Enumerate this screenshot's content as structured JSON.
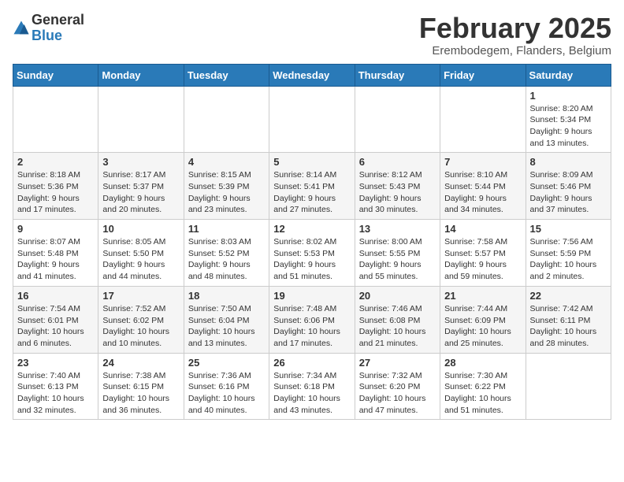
{
  "header": {
    "logo_general": "General",
    "logo_blue": "Blue",
    "month_title": "February 2025",
    "location": "Erembodegem, Flanders, Belgium"
  },
  "days_of_week": [
    "Sunday",
    "Monday",
    "Tuesday",
    "Wednesday",
    "Thursday",
    "Friday",
    "Saturday"
  ],
  "weeks": [
    {
      "shaded": false,
      "days": [
        {
          "number": "",
          "text": ""
        },
        {
          "number": "",
          "text": ""
        },
        {
          "number": "",
          "text": ""
        },
        {
          "number": "",
          "text": ""
        },
        {
          "number": "",
          "text": ""
        },
        {
          "number": "",
          "text": ""
        },
        {
          "number": "1",
          "text": "Sunrise: 8:20 AM\nSunset: 5:34 PM\nDaylight: 9 hours and 13 minutes."
        }
      ]
    },
    {
      "shaded": true,
      "days": [
        {
          "number": "2",
          "text": "Sunrise: 8:18 AM\nSunset: 5:36 PM\nDaylight: 9 hours and 17 minutes."
        },
        {
          "number": "3",
          "text": "Sunrise: 8:17 AM\nSunset: 5:37 PM\nDaylight: 9 hours and 20 minutes."
        },
        {
          "number": "4",
          "text": "Sunrise: 8:15 AM\nSunset: 5:39 PM\nDaylight: 9 hours and 23 minutes."
        },
        {
          "number": "5",
          "text": "Sunrise: 8:14 AM\nSunset: 5:41 PM\nDaylight: 9 hours and 27 minutes."
        },
        {
          "number": "6",
          "text": "Sunrise: 8:12 AM\nSunset: 5:43 PM\nDaylight: 9 hours and 30 minutes."
        },
        {
          "number": "7",
          "text": "Sunrise: 8:10 AM\nSunset: 5:44 PM\nDaylight: 9 hours and 34 minutes."
        },
        {
          "number": "8",
          "text": "Sunrise: 8:09 AM\nSunset: 5:46 PM\nDaylight: 9 hours and 37 minutes."
        }
      ]
    },
    {
      "shaded": false,
      "days": [
        {
          "number": "9",
          "text": "Sunrise: 8:07 AM\nSunset: 5:48 PM\nDaylight: 9 hours and 41 minutes."
        },
        {
          "number": "10",
          "text": "Sunrise: 8:05 AM\nSunset: 5:50 PM\nDaylight: 9 hours and 44 minutes."
        },
        {
          "number": "11",
          "text": "Sunrise: 8:03 AM\nSunset: 5:52 PM\nDaylight: 9 hours and 48 minutes."
        },
        {
          "number": "12",
          "text": "Sunrise: 8:02 AM\nSunset: 5:53 PM\nDaylight: 9 hours and 51 minutes."
        },
        {
          "number": "13",
          "text": "Sunrise: 8:00 AM\nSunset: 5:55 PM\nDaylight: 9 hours and 55 minutes."
        },
        {
          "number": "14",
          "text": "Sunrise: 7:58 AM\nSunset: 5:57 PM\nDaylight: 9 hours and 59 minutes."
        },
        {
          "number": "15",
          "text": "Sunrise: 7:56 AM\nSunset: 5:59 PM\nDaylight: 10 hours and 2 minutes."
        }
      ]
    },
    {
      "shaded": true,
      "days": [
        {
          "number": "16",
          "text": "Sunrise: 7:54 AM\nSunset: 6:01 PM\nDaylight: 10 hours and 6 minutes."
        },
        {
          "number": "17",
          "text": "Sunrise: 7:52 AM\nSunset: 6:02 PM\nDaylight: 10 hours and 10 minutes."
        },
        {
          "number": "18",
          "text": "Sunrise: 7:50 AM\nSunset: 6:04 PM\nDaylight: 10 hours and 13 minutes."
        },
        {
          "number": "19",
          "text": "Sunrise: 7:48 AM\nSunset: 6:06 PM\nDaylight: 10 hours and 17 minutes."
        },
        {
          "number": "20",
          "text": "Sunrise: 7:46 AM\nSunset: 6:08 PM\nDaylight: 10 hours and 21 minutes."
        },
        {
          "number": "21",
          "text": "Sunrise: 7:44 AM\nSunset: 6:09 PM\nDaylight: 10 hours and 25 minutes."
        },
        {
          "number": "22",
          "text": "Sunrise: 7:42 AM\nSunset: 6:11 PM\nDaylight: 10 hours and 28 minutes."
        }
      ]
    },
    {
      "shaded": false,
      "days": [
        {
          "number": "23",
          "text": "Sunrise: 7:40 AM\nSunset: 6:13 PM\nDaylight: 10 hours and 32 minutes."
        },
        {
          "number": "24",
          "text": "Sunrise: 7:38 AM\nSunset: 6:15 PM\nDaylight: 10 hours and 36 minutes."
        },
        {
          "number": "25",
          "text": "Sunrise: 7:36 AM\nSunset: 6:16 PM\nDaylight: 10 hours and 40 minutes."
        },
        {
          "number": "26",
          "text": "Sunrise: 7:34 AM\nSunset: 6:18 PM\nDaylight: 10 hours and 43 minutes."
        },
        {
          "number": "27",
          "text": "Sunrise: 7:32 AM\nSunset: 6:20 PM\nDaylight: 10 hours and 47 minutes."
        },
        {
          "number": "28",
          "text": "Sunrise: 7:30 AM\nSunset: 6:22 PM\nDaylight: 10 hours and 51 minutes."
        },
        {
          "number": "",
          "text": ""
        }
      ]
    }
  ]
}
